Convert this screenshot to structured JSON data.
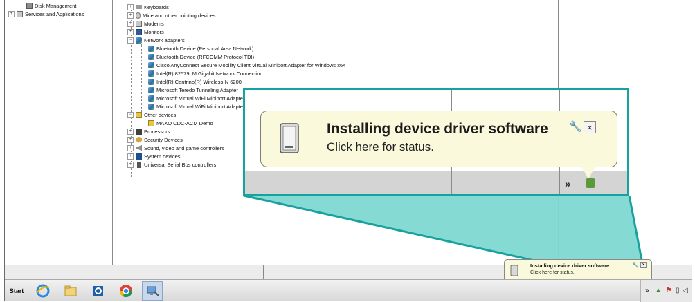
{
  "left_pane": {
    "items": [
      {
        "label": "Disk Management"
      },
      {
        "label": "Services and Applications"
      }
    ]
  },
  "device_tree": {
    "categories": [
      {
        "label": "Keyboards"
      },
      {
        "label": "Mice and other pointing devices"
      },
      {
        "label": "Modems"
      },
      {
        "label": "Monitors"
      },
      {
        "label": "Network adapters"
      }
    ],
    "network_adapters": [
      {
        "label": "Bluetooth Device (Personal Area Network)"
      },
      {
        "label": "Bluetooth Device (RFCOMM Protocol TDI)"
      },
      {
        "label": "Cisco AnyConnect Secure Mobility Client Virtual Miniport Adapter for Windows x64"
      },
      {
        "label": "Intel(R) 82579LM Gigabit Network Connection"
      },
      {
        "label": "Intel(R) Centrino(R) Wireless-N 6200"
      },
      {
        "label": "Microsoft Teredo Tunneling Adapter"
      },
      {
        "label": "Microsoft Virtual WiFi Miniport Adapter"
      },
      {
        "label": "Microsoft Virtual WiFi Miniport Adapter"
      }
    ],
    "other_devices": {
      "label": "Other devices",
      "children": [
        {
          "label": "MAXQ CDC-ACM Demo"
        }
      ]
    },
    "more_categories": [
      {
        "label": "Processors"
      },
      {
        "label": "Security Devices"
      },
      {
        "label": "Sound, video and game controllers"
      },
      {
        "label": "System devices"
      },
      {
        "label": "Universal Serial Bus controllers"
      }
    ]
  },
  "notification": {
    "title": "Installing device driver software",
    "subtitle": "Click here for status.",
    "tool_icon": "wrench-icon",
    "close_icon": "close-icon",
    "close_label": "×"
  },
  "taskbar": {
    "start_label": "Start",
    "pinned": [
      "internet-explorer-icon",
      "folder-icon",
      "outlook-icon",
      "chrome-icon",
      "device-manager-icon"
    ],
    "tray": [
      "chevron-up-icon",
      "device-install-icon",
      "flag-icon",
      "battery-icon",
      "speaker-icon"
    ],
    "chevron_label": "»"
  },
  "colors": {
    "highlight": "#17a2a0",
    "highlight_fill": "#7fd8d2",
    "balloon": "#fbf9dc"
  }
}
